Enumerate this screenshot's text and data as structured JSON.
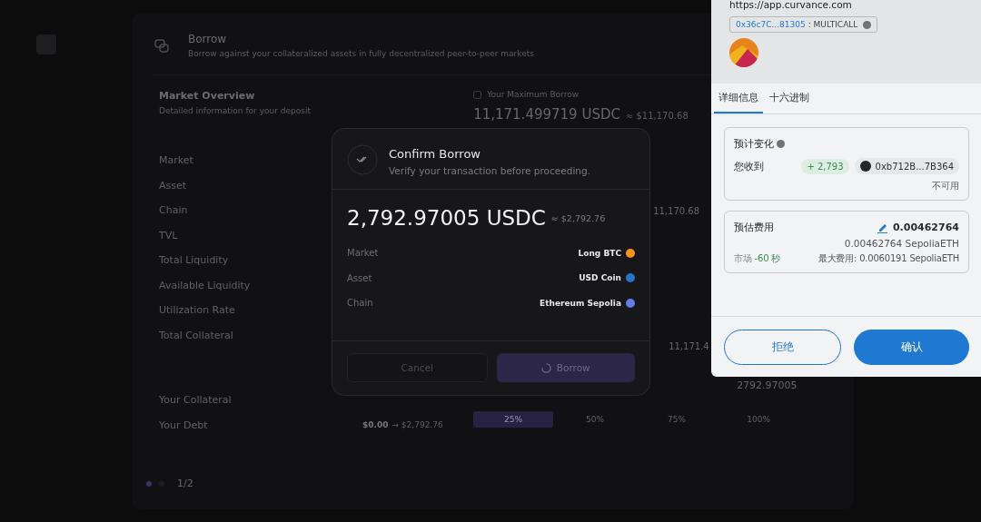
{
  "page": {
    "title": "Borrow",
    "subtitle": "Borrow against your collateralized assets in fully decentralized peer-to-peer markets"
  },
  "overview": {
    "title": "Market Overview",
    "subtitle": "Detailed information for your deposit",
    "rows": [
      "Market",
      "Asset",
      "Chain",
      "TVL",
      "Total Liquidity",
      "Available Liquidity",
      "Utilization Rate",
      "Total Collateral"
    ],
    "collateral_label": "Your Collateral",
    "debt_label": "Your Debt",
    "debt_from": "$0.00",
    "debt_to": "→ $2,792.76"
  },
  "max_borrow": {
    "label": "Your Maximum Borrow",
    "amount": "11,171.499719 USDC",
    "usd": "≈ $11,170.68",
    "fragments": [
      "11,170.68",
      "11,171.4",
      "2792.97005"
    ]
  },
  "ltv_steps": [
    {
      "label": "25%",
      "selected": true
    },
    {
      "label": "50%",
      "selected": false
    },
    {
      "label": "75%",
      "selected": false
    },
    {
      "label": "100%",
      "selected": false
    }
  ],
  "pager": {
    "dots": [
      {
        "selected": true
      },
      {
        "selected": false
      }
    ],
    "text": "1/2"
  },
  "modal": {
    "title": "Confirm Borrow",
    "subtitle": "Verify your transaction before proceeding.",
    "amount": "2,792.97005 USDC",
    "usd": "≈ $2,792.76",
    "details": [
      {
        "label": "Market",
        "value": "Long BTC",
        "color": "#f7931a"
      },
      {
        "label": "Asset",
        "value": "USD Coin",
        "color": "#2775ca"
      },
      {
        "label": "Chain",
        "value": "Ethereum Sepolia",
        "color": "#627eea"
      }
    ],
    "cancel": "Cancel",
    "confirm": "Borrow",
    "loading": true
  },
  "wallet": {
    "origin": "https://app.curvance.com",
    "contract": "0x36c7C...81305",
    "method": ": MULTICALL",
    "tabs": [
      {
        "label": "详细信息",
        "selected": true
      },
      {
        "label": "十六进制",
        "selected": false
      }
    ],
    "changes": {
      "title": "预计变化",
      "receive_label": "您收到",
      "delta": "+ 2,793",
      "token": "0xb712B...7B364",
      "token_note": "不可用"
    },
    "fee": {
      "title": "预估费用",
      "amount": "0.00462764",
      "amount_full": "0.00462764 SepoliaETH",
      "speed_label": "市场",
      "speed_time": "-60 秒",
      "max_fee": "最大费用: 0.0060191 SepoliaETH"
    },
    "reject": "拒绝",
    "confirm": "确认"
  }
}
